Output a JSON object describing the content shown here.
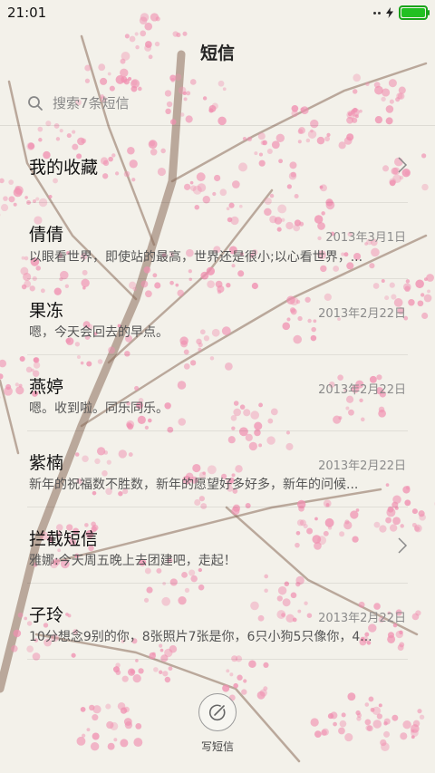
{
  "status_bar": {
    "time": "21:01",
    "battery_color": "#22c022"
  },
  "header": {
    "title": "短信"
  },
  "search": {
    "placeholder": "搜索7条短信"
  },
  "list": {
    "favorites": {
      "label": "我的收藏"
    },
    "conversations": [
      {
        "name": "倩倩",
        "date": "2013年3月1日",
        "preview": "以眼看世界，即使站的最高，世界还是很小;以心看世界，..."
      },
      {
        "name": "果冻",
        "date": "2013年2月22日",
        "preview": "嗯，今天会回去的早点。"
      },
      {
        "name": "燕婷",
        "date": "2013年2月22日",
        "preview": "嗯。收到啦。同乐同乐。"
      },
      {
        "name": "紫楠",
        "date": "2013年2月22日",
        "preview": "新年的祝福数不胜数，新年的愿望好多好多，新年的问候..."
      }
    ],
    "blocked": {
      "label": "拦截短信",
      "preview": "雅娜:今天周五晚上去团建吧，走起！"
    },
    "last": {
      "name": "子玲",
      "date": "2013年2月22日",
      "preview": "10分想念9别的你，8张照片7张是你，6只小狗5只像你，4..."
    }
  },
  "compose": {
    "label": "写短信",
    "icon": "compose-icon"
  },
  "theme": {
    "blossom_color": "#f08fb0",
    "branch_color": "#8a6b5a"
  }
}
